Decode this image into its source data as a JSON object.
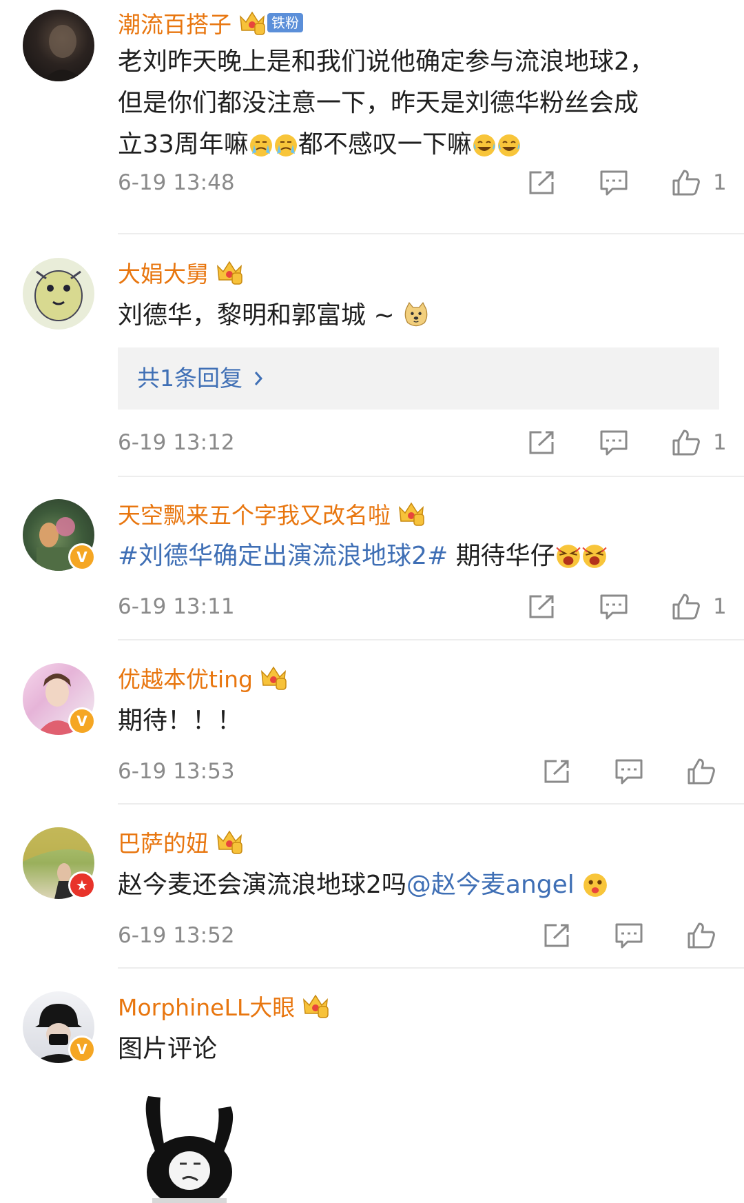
{
  "colors": {
    "name": "#e8760f",
    "link": "#3f6fb5",
    "meta": "#8a8a8a"
  },
  "comments": [
    {
      "name": "潮流百搭子",
      "fans_badge": "铁粉",
      "crown_level": "6",
      "text_1": "老刘昨天晚上是和我们说他确定参与流浪地球2，",
      "text_2": "但是你们都没注意一下，昨天是刘德华粉丝会成",
      "text_3": "立33周年嘛",
      "text_4": "都不感叹一下嘛",
      "time": "6-19 13:48",
      "likes": "1"
    },
    {
      "name": "大娟大舅",
      "crown_level": "5",
      "text": "刘德华，黎明和郭富城 ~",
      "replies": "共1条回复",
      "time": "6-19 13:12",
      "likes": "1"
    },
    {
      "name": "天空飘来五个字我又改名啦",
      "crown_level": "4",
      "hashtag": "#刘德华确定出演流浪地球2#",
      "text": " 期待华仔",
      "badge": "V",
      "time": "6-19 13:11",
      "likes": "1"
    },
    {
      "name": "优越本优ting",
      "crown_level": "4",
      "text": "期待！！！",
      "badge": "V",
      "time": "6-19 13:53"
    },
    {
      "name": "巴萨的妞",
      "crown_level": "3",
      "text": "赵今麦还会演流浪地球2吗",
      "mention": "@赵今麦angel",
      "time": "6-19 13:52"
    },
    {
      "name": "MorphineLL大眼",
      "crown_level": "5",
      "text": "图片评论",
      "badge": "V"
    }
  ],
  "icons": [
    "share-icon",
    "comment-icon",
    "like-icon"
  ]
}
